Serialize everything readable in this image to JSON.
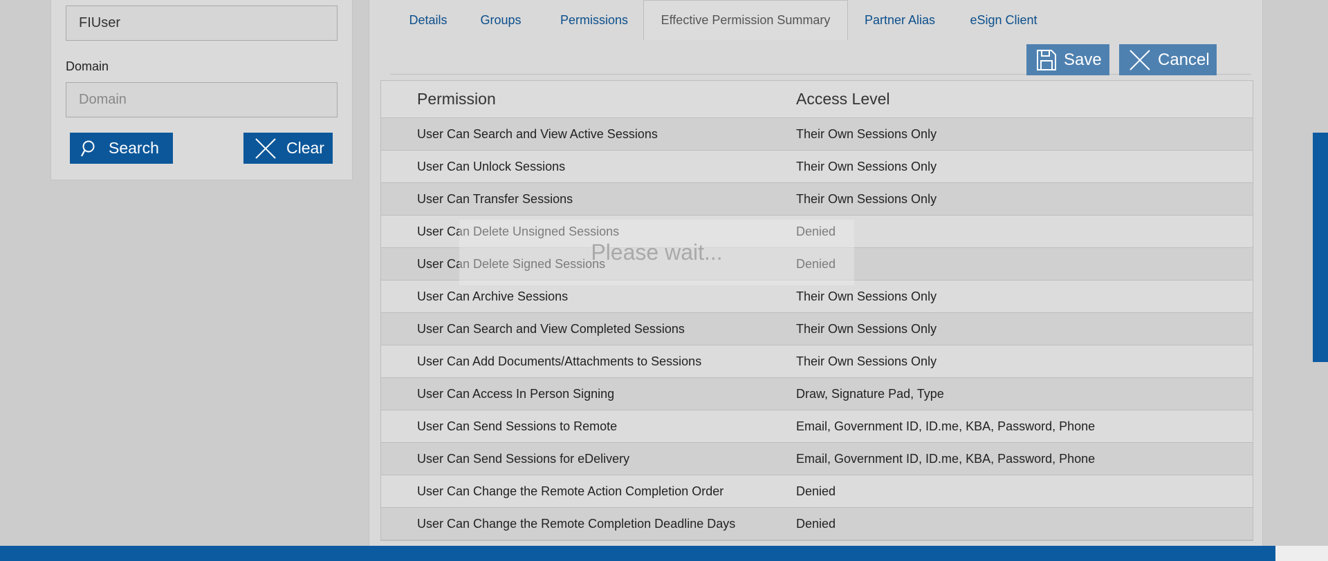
{
  "search_panel": {
    "username_value": "FIUser",
    "domain_label": "Domain",
    "domain_placeholder": "Domain",
    "search_label": "Search",
    "clear_label": "Clear"
  },
  "tabs": [
    {
      "label": "Details"
    },
    {
      "label": "Groups"
    },
    {
      "label": "Permissions"
    },
    {
      "label": "Effective Permission Summary",
      "active": true
    },
    {
      "label": "Partner Alias"
    },
    {
      "label": "eSign Client"
    }
  ],
  "actions": {
    "save_label": "Save",
    "cancel_label": "Cancel"
  },
  "table": {
    "headers": [
      "Permission",
      "Access Level"
    ],
    "rows": [
      {
        "permission": "User Can Search and View Active Sessions",
        "access": "Their Own Sessions Only"
      },
      {
        "permission": "User Can Unlock Sessions",
        "access": "Their Own Sessions Only"
      },
      {
        "permission": "User Can Transfer Sessions",
        "access": "Their Own Sessions Only"
      },
      {
        "permission": "User Can Delete Unsigned Sessions",
        "access": "Denied"
      },
      {
        "permission": "User Can Delete Signed Sessions",
        "access": "Denied"
      },
      {
        "permission": "User Can Archive Sessions",
        "access": "Their Own Sessions Only"
      },
      {
        "permission": "User Can Search and View Completed Sessions",
        "access": "Their Own Sessions Only"
      },
      {
        "permission": "User Can Add Documents/Attachments to Sessions",
        "access": "Their Own Sessions Only"
      },
      {
        "permission": "User Can Access In Person Signing",
        "access": "Draw, Signature Pad, Type"
      },
      {
        "permission": "User Can Send Sessions to Remote",
        "access": "Email, Government ID, ID.me, KBA, Password, Phone"
      },
      {
        "permission": "User Can Send Sessions for eDelivery",
        "access": "Email, Government ID, ID.me, KBA, Password, Phone"
      },
      {
        "permission": "User Can Change the Remote Action Completion Order",
        "access": "Denied"
      },
      {
        "permission": "User Can Change the Remote Completion Deadline Days",
        "access": "Denied"
      }
    ]
  },
  "overlay": {
    "message": "Please wait..."
  },
  "colors": {
    "brand_blue": "#0c579a",
    "action_blue": "#4f81b0",
    "link_blue": "#0c4f8c"
  }
}
